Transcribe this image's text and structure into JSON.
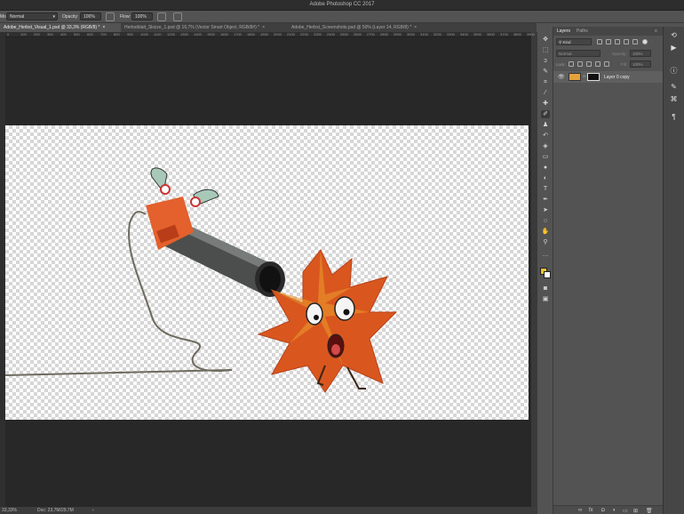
{
  "window": {
    "title": "Adobe Photoshop CC 2017"
  },
  "options": {
    "mode_label": "Mode:",
    "mode_value": "Normal",
    "opacity_label": "Opacity:",
    "opacity_value": "100%",
    "flow_label": "Flow:",
    "flow_value": "100%"
  },
  "tabs": [
    {
      "label": "Adobe_Herbst_Visual_1.psd @ 33,3% (RGB/8) *",
      "active": true
    },
    {
      "label": "Herbstblatt_Skizze_1.psd @ 16,7% (Vector Smart Object, RGB/8#) *",
      "active": false
    },
    {
      "label": "Adobe_Herbst_Screenshots.psd @ 50% (Layer 14, RGB/8) *",
      "active": false
    }
  ],
  "ruler": [
    "0",
    "100",
    "200",
    "300",
    "400",
    "500",
    "600",
    "700",
    "800",
    "900",
    "1000",
    "1100",
    "1200",
    "1300",
    "1400",
    "1500",
    "1600",
    "1700",
    "1800",
    "1900",
    "2000",
    "2100",
    "2200",
    "2300",
    "2400",
    "2500",
    "2600",
    "2700",
    "2800",
    "2900",
    "3000",
    "3100",
    "3200",
    "3300",
    "3400",
    "3500",
    "3600",
    "3700",
    "3800",
    "3900"
  ],
  "status": {
    "zoom": "33,33%",
    "doc": "Doc: 23,7M/29,7M"
  },
  "layers_panel": {
    "tab_layers": "Layers",
    "tab_paths": "Paths",
    "filter_kind": "Kind",
    "blend_mode": "Normal",
    "opacity_label": "Opacity:",
    "opacity_value": "100%",
    "lock_label": "Lock:",
    "fill_label": "Fill:",
    "fill_value": "100%",
    "layers": [
      {
        "name": "Layer 0 copy",
        "visible": true
      }
    ]
  },
  "colors": {
    "foreground": "#e8c52f",
    "background": "#ffffff",
    "accent": "#3a7bd5"
  }
}
